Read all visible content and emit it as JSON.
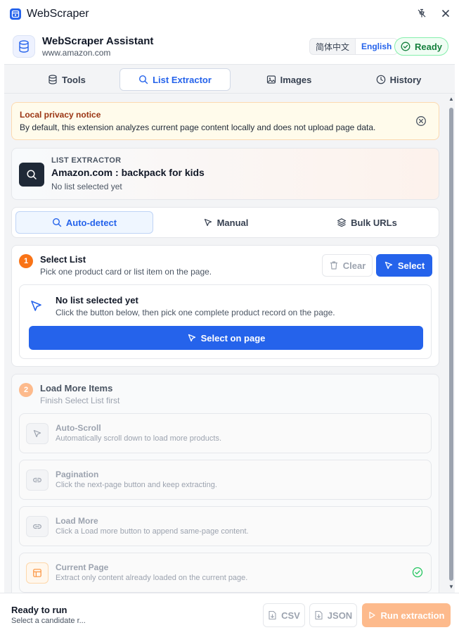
{
  "window": {
    "title": "WebScraper"
  },
  "header": {
    "title": "WebScraper Assistant",
    "domain": "www.amazon.com",
    "languages": [
      "简体中文",
      "English"
    ],
    "active_language": "English",
    "status": "Ready"
  },
  "tabs": [
    {
      "label": "Tools",
      "icon": "database-icon"
    },
    {
      "label": "List Extractor",
      "icon": "search-icon",
      "active": true
    },
    {
      "label": "Images",
      "icon": "image-icon"
    },
    {
      "label": "History",
      "icon": "clock-icon"
    }
  ],
  "notice": {
    "title": "Local privacy notice",
    "text": "By default, this extension analyzes current page content locally and does not upload page data."
  },
  "extractor": {
    "kicker": "LIST EXTRACTOR",
    "title": "Amazon.com : backpack for kids",
    "subtitle": "No list selected yet"
  },
  "modes": [
    {
      "label": "Auto-detect",
      "icon": "search-icon",
      "active": true
    },
    {
      "label": "Manual",
      "icon": "cursor-icon"
    },
    {
      "label": "Bulk URLs",
      "icon": "layers-icon"
    }
  ],
  "step1": {
    "number": "1",
    "title": "Select List",
    "subtitle": "Pick one product card or list item on the page.",
    "clear_label": "Clear",
    "select_label": "Select",
    "empty_title": "No list selected yet",
    "empty_text": "Click the button below, then pick one complete product record on the page.",
    "select_on_page_label": "Select on page"
  },
  "step2": {
    "number": "2",
    "title": "Load More Items",
    "subtitle": "Finish Select List first",
    "options": [
      {
        "title": "Auto-Scroll",
        "description": "Automatically scroll down to load more products.",
        "icon": "cursor-icon"
      },
      {
        "title": "Pagination",
        "description": "Click the next-page button and keep extracting.",
        "icon": "link-icon"
      },
      {
        "title": "Load More",
        "description": "Click a Load more button to append same-page content.",
        "icon": "link-icon"
      },
      {
        "title": "Current Page",
        "description": "Extract only content already loaded on the current page.",
        "icon": "table-icon",
        "selected": true
      }
    ]
  },
  "footer": {
    "title": "Ready to run",
    "subtitle": "Select a candidate r...",
    "csv_label": "CSV",
    "json_label": "JSON",
    "run_label": "Run extraction"
  },
  "colors": {
    "accent": "#2563eb",
    "ready_green": "#15803d",
    "step1_badge": "#f97316",
    "step2_badge": "#fdba8c",
    "notice_title": "#9a3412"
  }
}
